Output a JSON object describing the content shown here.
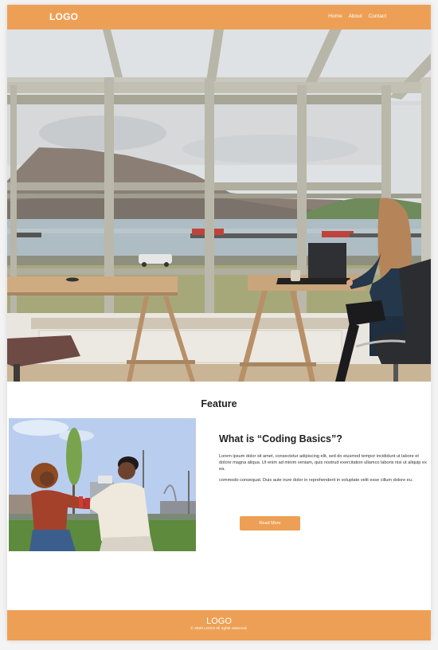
{
  "header": {
    "logo": "LOGO",
    "nav": [
      {
        "label": "Home"
      },
      {
        "label": "About"
      },
      {
        "label": "Contact"
      }
    ]
  },
  "feature": {
    "section_title": "Feature",
    "heading": "What is “Coding Basics”?",
    "paragraphs": [
      "Lorem ipsum dolor sit amet, consectetur adipiscing elit, sed do eiusmod tempor incididunt ut labore et dolore magna aliqua. Ut enim ad minim veniam, quis nostrud exercitation ullamco laboris nisi ut aliquip ex ea.",
      "commodo consequat. Duis aute irure dolor in reprehenderit in voluptate velit esse cillum dolore eu."
    ],
    "button_label": "Read More"
  },
  "footer": {
    "logo": "LOGO",
    "copyright": "© 2020 LOGO All rights reserved."
  },
  "colors": {
    "accent": "#eda055",
    "background": "#ffffff",
    "text": "#222222"
  }
}
